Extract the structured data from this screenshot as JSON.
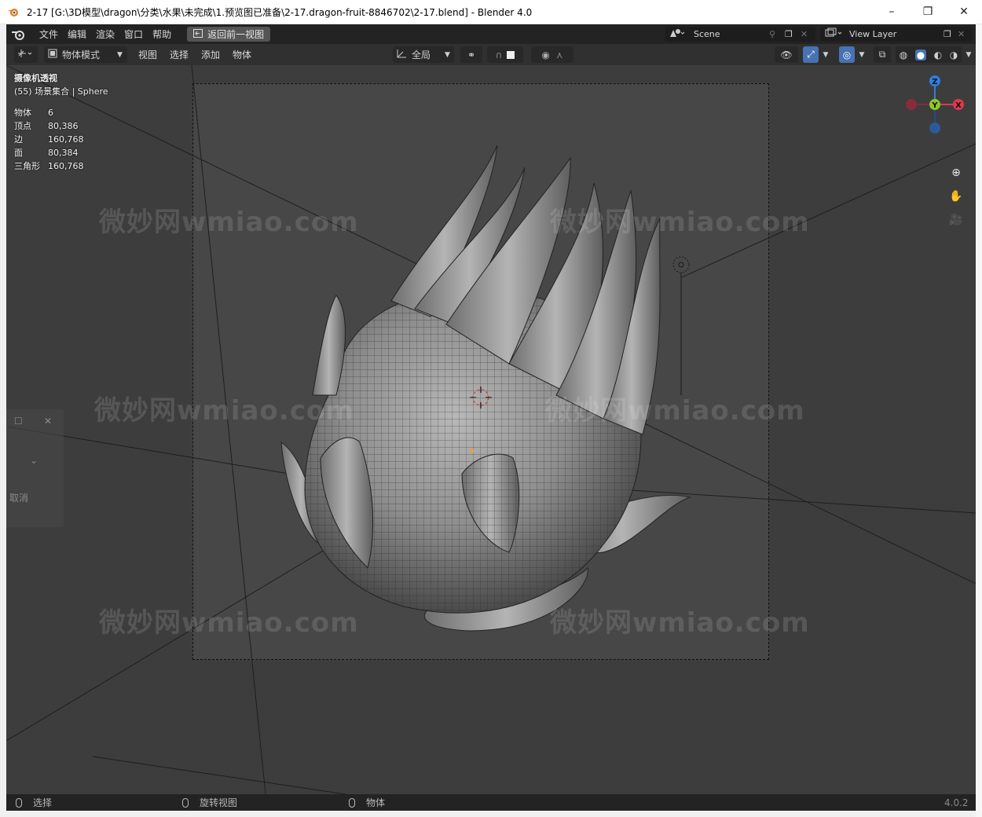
{
  "window": {
    "title": "2-17 [G:\\3D模型\\dragon\\分类\\水果\\未完成\\1.预览图已准备\\2-17.dragon-fruit-8846702\\2-17.blend] - Blender 4.0",
    "minimize": "–",
    "restore": "❐",
    "close": "✕"
  },
  "menubar": {
    "items": [
      "文件",
      "编辑",
      "渲染",
      "窗口",
      "帮助"
    ],
    "back_button": "返回前一视图",
    "scene_name": "Scene",
    "view_layer": "View Layer"
  },
  "header": {
    "mode": "物体模式",
    "menus": [
      "视图",
      "选择",
      "添加",
      "物体"
    ],
    "transform_orientation": "全局"
  },
  "viewport": {
    "view_name": "摄像机透视",
    "collection": "(55) 场景集合 | Sphere",
    "stats": [
      {
        "label": "物体",
        "value": "6"
      },
      {
        "label": "顶点",
        "value": "80,386"
      },
      {
        "label": "边",
        "value": "160,768"
      },
      {
        "label": "面",
        "value": "80,384"
      },
      {
        "label": "三角形",
        "value": "160,768"
      }
    ],
    "watermark": "微妙网wmiao.com",
    "gizmo": {
      "z": "Z",
      "y": "Y",
      "x": "X"
    },
    "left_panel_cancel": "取消"
  },
  "statusbar": {
    "select": "选择",
    "rotate": "旋转视图",
    "object": "物体",
    "version": "4.0.2"
  },
  "colors": {
    "x_axis": "#e0384f",
    "y_axis": "#8bc924",
    "z_axis": "#2e7fe0",
    "accent": "#4772b3"
  }
}
